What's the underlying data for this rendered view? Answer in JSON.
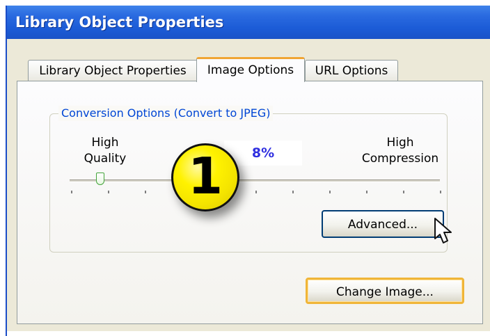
{
  "window": {
    "title": "Library Object Properties"
  },
  "tabs": [
    {
      "label": "Library Object Properties",
      "active": false
    },
    {
      "label": "Image Options",
      "active": true
    },
    {
      "label": "URL Options",
      "active": false
    }
  ],
  "conversion_group": {
    "legend": "Conversion Options (Convert to JPEG)",
    "left_label": "High\nQuality",
    "right_label": "High\nCompression",
    "value_display": "8%",
    "slider_value_fraction": 0.08,
    "tick_count": 11,
    "advanced_button_label": "Advanced..."
  },
  "change_image_button_label": "Change Image...",
  "callout": {
    "step_number": "1"
  },
  "icons": {
    "cursor": "mouse-pointer-icon"
  },
  "colors": {
    "title_bar": "#1b5bd6",
    "legend_text": "#0046d5",
    "value_text": "#2f2fe0",
    "active_tab_accent": "#f0a534",
    "callout_badge": "#fff200",
    "slider_thumb_border": "#42a339"
  }
}
